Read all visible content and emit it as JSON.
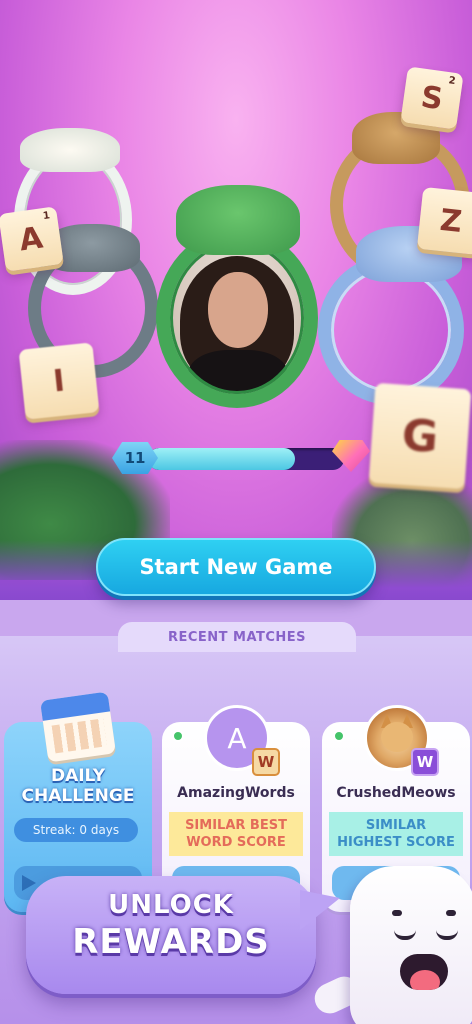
{
  "level": {
    "number": "11",
    "progress": 0.75
  },
  "letter_tiles": [
    {
      "letter": "A",
      "points": "1"
    },
    {
      "letter": "I",
      "points": ""
    },
    {
      "letter": "S",
      "points": "2"
    },
    {
      "letter": "Z",
      "points": ""
    },
    {
      "letter": "G",
      "points": ""
    }
  ],
  "start_button": {
    "label": "Start New Game"
  },
  "recent_matches": {
    "label": "RECENT MATCHES"
  },
  "daily_challenge": {
    "title_line1": "DAILY",
    "title_line2": "CHALLENGE",
    "streak": "Streak: 0 days"
  },
  "matches": [
    {
      "name": "AmazingWords",
      "avatar_letter": "A",
      "badge": "W",
      "stat_line1": "SIMILAR BEST",
      "stat_line2": "WORD SCORE"
    },
    {
      "name": "CrushedMeows",
      "avatar_letter": "",
      "badge": "W",
      "stat_line1": "SIMILAR",
      "stat_line2": "HIGHEST SCORE"
    }
  ],
  "promo": {
    "line1": "UNLOCK",
    "line2": "REWARDS"
  },
  "colors": {
    "start_button": "#1fb8ea",
    "level_fill": "#4cc7e3",
    "panel": "#c4a9f0"
  }
}
